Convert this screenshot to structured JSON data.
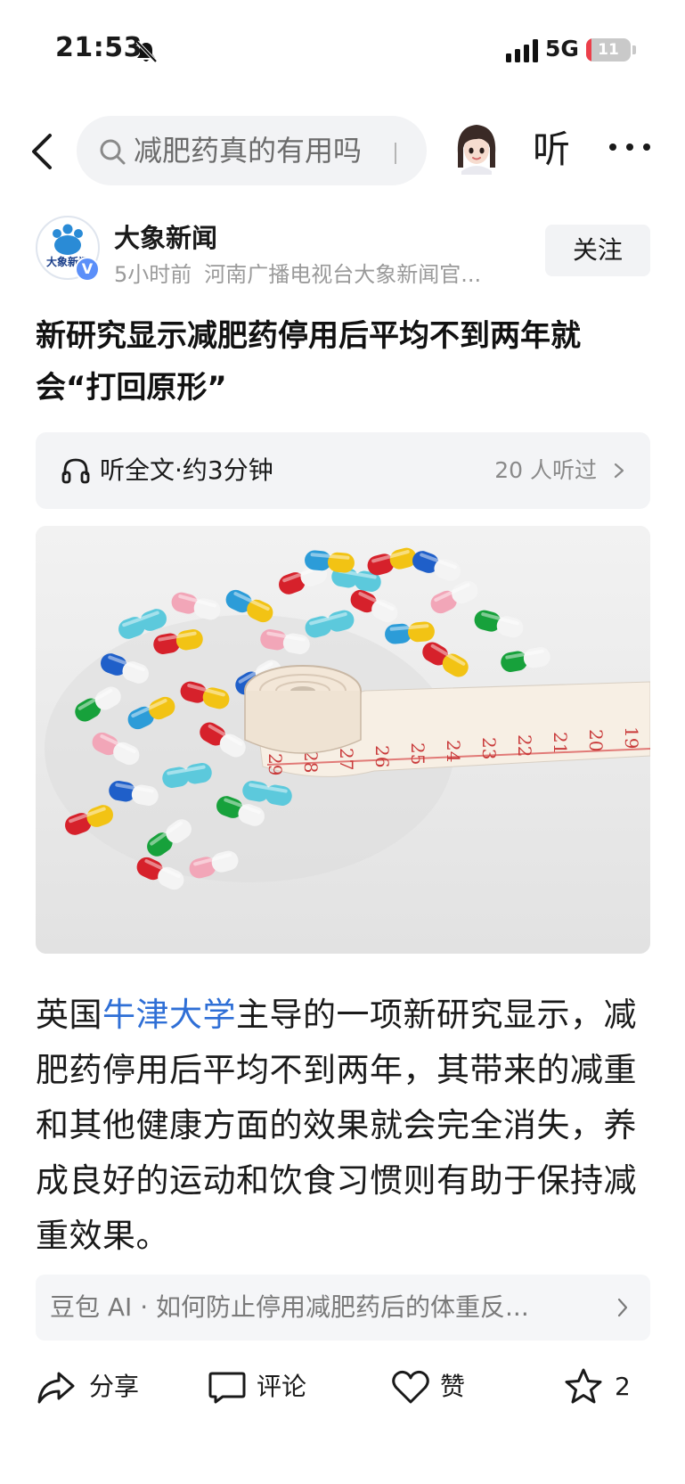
{
  "status_bar": {
    "time": "21:53",
    "network": "5G",
    "battery": "11",
    "battery_level": 0.11,
    "accent_battery": "#ec3f4a"
  },
  "top_bar": {
    "search_text": "减肥药真的有用吗",
    "listen_label": "听",
    "icons": [
      "back-icon",
      "search-icon",
      "avatar",
      "more-icon"
    ]
  },
  "author": {
    "name": "大象新闻",
    "logo_text": "大象新闻",
    "time": "5小时前",
    "source": "河南广播电视台大象新闻官...",
    "follow_label": "关注",
    "verified_color": "#5b8ff9"
  },
  "article": {
    "title": "新研究显示减肥药停用后平均不到两年就会“打回原形”",
    "listen_label": "听全文·约3分钟",
    "listen_count": "20 人听过",
    "body_before": "英国",
    "body_link": "牛津大学",
    "body_after": "主导的一项新研究显示，减肥药停用后平均不到两年，其带来的减重和其他健康方面的效果就会完全消失，养成良好的运动和饮食习惯则有助于保持减重效果。",
    "link_color": "#2f6fd6"
  },
  "hero_image": {
    "description_icon": "pills-and-measuring-tape-image",
    "tape_numbers": [
      "29",
      "28",
      "27",
      "26",
      "25",
      "24",
      "23",
      "22",
      "21",
      "20",
      "19"
    ]
  },
  "ai_suggestion": {
    "text": "豆包 AI · 如何防止停用减肥药后的体重反..."
  },
  "bottom_bar": {
    "share_label": "分享",
    "comment_label": "评论",
    "like_label": "赞",
    "favorite_count": "2"
  }
}
